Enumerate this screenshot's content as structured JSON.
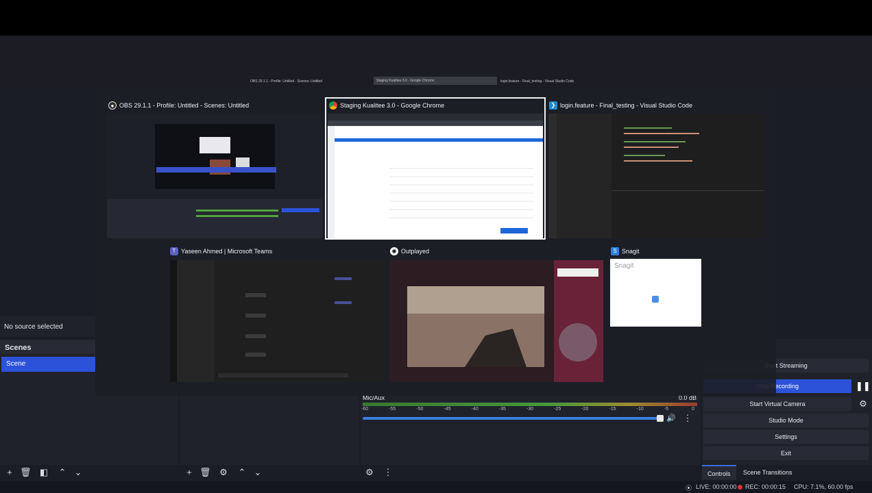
{
  "obs": {
    "no_source": "No source selected",
    "scenes_header": "Scenes",
    "scene_name": "Scene",
    "mixer": {
      "track_name": "Mic/Aux",
      "level": "0.0 dB",
      "scale": [
        "-60",
        "-55",
        "-50",
        "-45",
        "-40",
        "-35",
        "-30",
        "-25",
        "-20",
        "-15",
        "-10",
        "-5",
        "0"
      ]
    },
    "controls": {
      "start_streaming": "Start Streaming",
      "stop_recording": "Stop Recording",
      "start_virtual_camera": "Start Virtual Camera",
      "studio_mode": "Studio Mode",
      "settings": "Settings",
      "exit": "Exit"
    },
    "tabs": {
      "controls": "Controls",
      "scene_transitions": "Scene Transitions"
    },
    "status": {
      "live": "LIVE: 00:00:00",
      "rec": "REC: 00:00:15",
      "cpu": "CPU: 7.1%, 60.00 fps"
    }
  },
  "alt_tab": {
    "top_row": [
      "OBS 29.1.1 - Profile: Untitled - Scenes: Untitled",
      "Staging Kualitee 3.0 - Google Chrome",
      "login.feature - Final_testing - Visual Studio Code"
    ],
    "bottom_row": [
      "Yaseen Ahmed | Microsoft Teams",
      "Outplayed",
      "Snagit"
    ],
    "snagit_label": "Snagit"
  },
  "colors": {
    "accent": "#2b52d9",
    "panel": "#20222b",
    "background": "#1b1d26"
  }
}
